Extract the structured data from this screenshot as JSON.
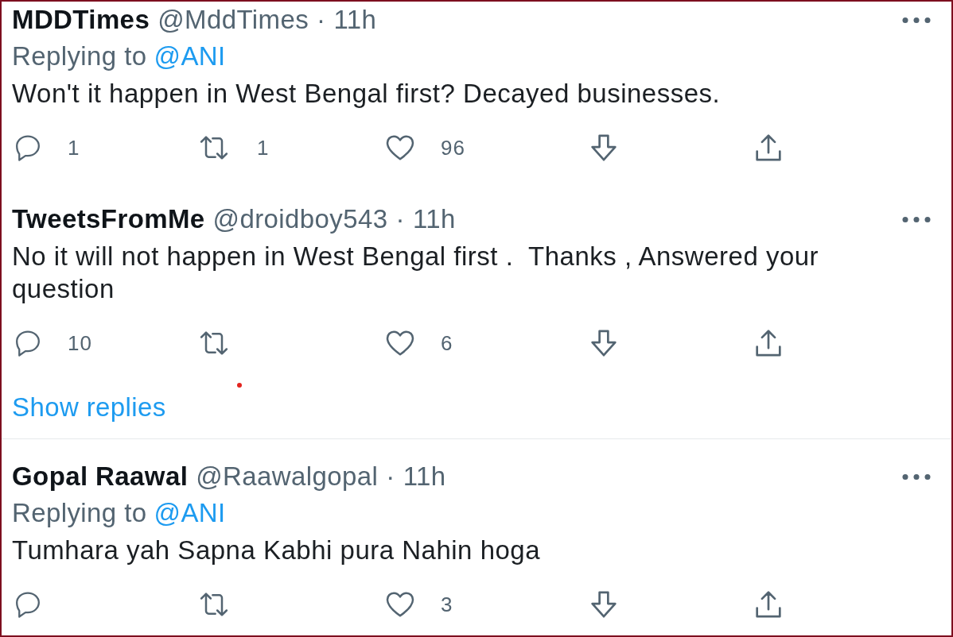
{
  "threads": [
    {
      "tweets": [
        {
          "name": "MDDTimes",
          "handle": "@MddTimes",
          "separator": "·",
          "time": "11h",
          "replying_to": {
            "label": "Replying to",
            "mention": "@ANI"
          },
          "text": "Won't it happen in West Bengal first? Decayed businesses.",
          "actions": [
            {
              "kind": "reply",
              "count": "1"
            },
            {
              "kind": "retweet",
              "count": "1"
            },
            {
              "kind": "like",
              "count": "96"
            },
            {
              "kind": "downvote"
            },
            {
              "kind": "share"
            }
          ]
        },
        {
          "name": "TweetsFromMe",
          "handle": "@droidboy543",
          "separator": "·",
          "time": "11h",
          "text": "No it will not happen in West Bengal first .  Thanks , Answered your question",
          "actions": [
            {
              "kind": "reply",
              "count": "10"
            },
            {
              "kind": "retweet"
            },
            {
              "kind": "like",
              "count": "6"
            },
            {
              "kind": "downvote"
            },
            {
              "kind": "share"
            }
          ]
        }
      ],
      "show_replies": "Show replies"
    },
    {
      "tweets": [
        {
          "name": "Gopal Raawal",
          "handle": "@Raawalgopal",
          "separator": "·",
          "time": "11h",
          "replying_to": {
            "label": "Replying to",
            "mention": "@ANI"
          },
          "text": "Tumhara yah Sapna Kabhi pura Nahin hoga",
          "actions": [
            {
              "kind": "reply"
            },
            {
              "kind": "retweet"
            },
            {
              "kind": "like",
              "count": "3"
            },
            {
              "kind": "downvote"
            },
            {
              "kind": "share"
            }
          ]
        }
      ]
    }
  ]
}
